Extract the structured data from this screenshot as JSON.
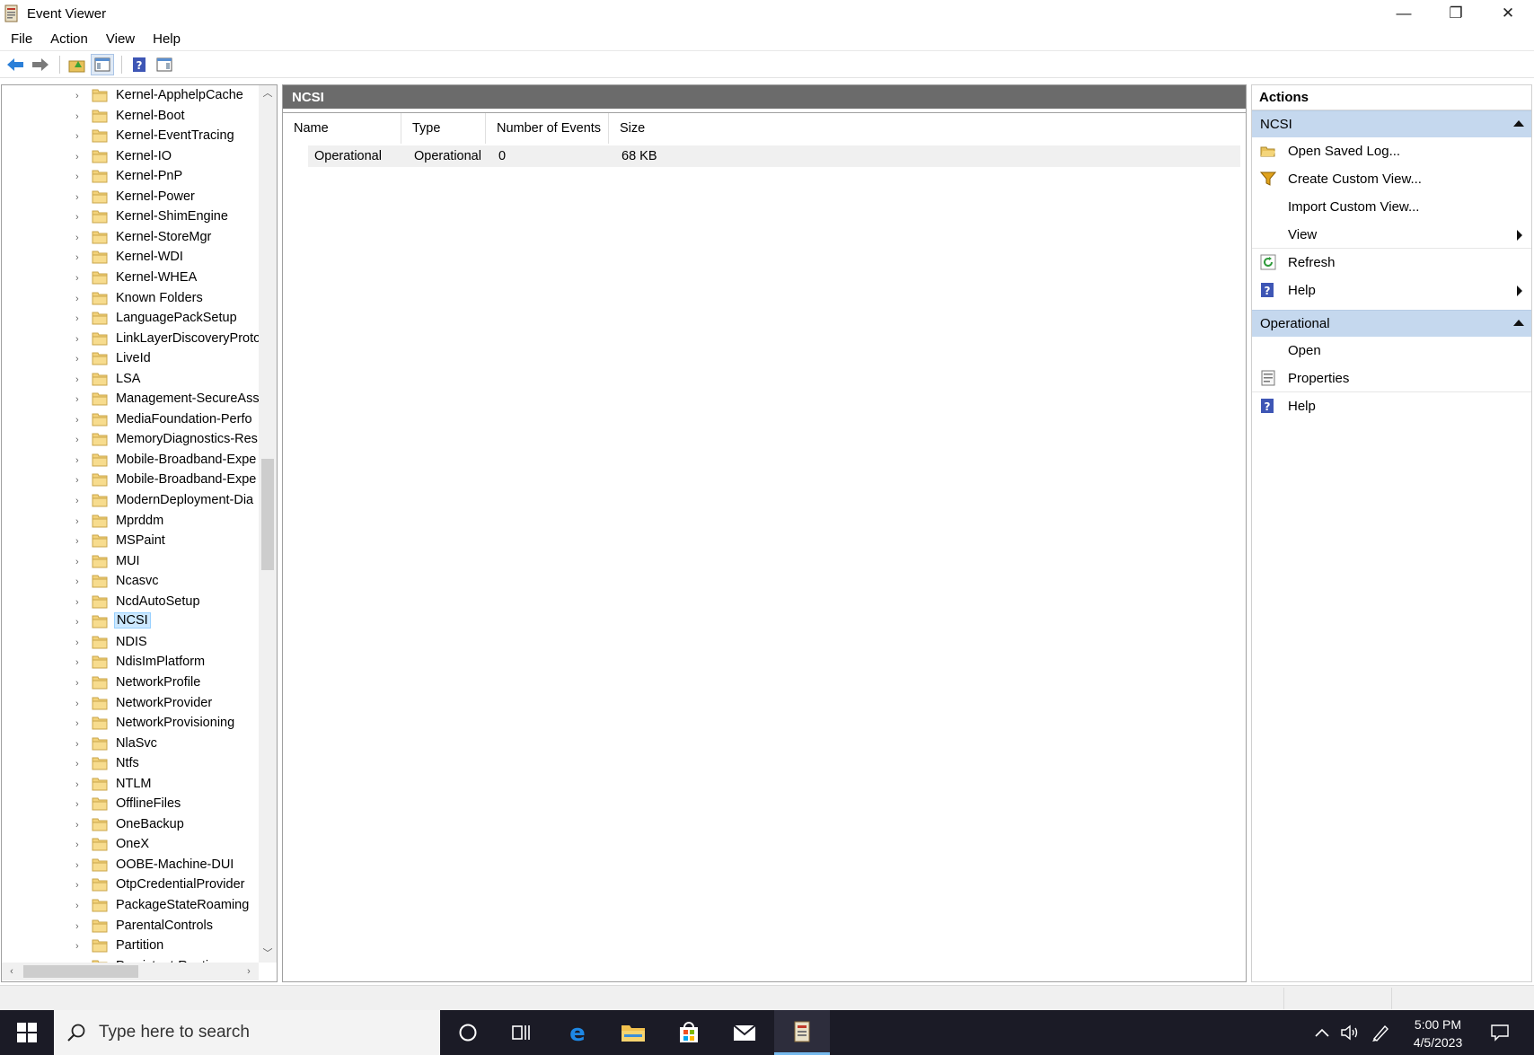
{
  "window": {
    "title": "Event Viewer",
    "minimize": "—",
    "restore": "❐",
    "close": "✕"
  },
  "menu": [
    "File",
    "Action",
    "View",
    "Help"
  ],
  "tree": {
    "items": [
      "Kernel-ApphelpCache",
      "Kernel-Boot",
      "Kernel-EventTracing",
      "Kernel-IO",
      "Kernel-PnP",
      "Kernel-Power",
      "Kernel-ShimEngine",
      "Kernel-StoreMgr",
      "Kernel-WDI",
      "Kernel-WHEA",
      "Known Folders",
      "LanguagePackSetup",
      "LinkLayerDiscoveryProto",
      "LiveId",
      "LSA",
      "Management-SecureAss",
      "MediaFoundation-Perfo",
      "MemoryDiagnostics-Res",
      "Mobile-Broadband-Expe",
      "Mobile-Broadband-Expe",
      "ModernDeployment-Dia",
      "Mprddm",
      "MSPaint",
      "MUI",
      "Ncasvc",
      "NcdAutoSetup",
      "NCSI",
      "NDIS",
      "NdisImPlatform",
      "NetworkProfile",
      "NetworkProvider",
      "NetworkProvisioning",
      "NlaSvc",
      "Ntfs",
      "NTLM",
      "OfflineFiles",
      "OneBackup",
      "OneX",
      "OOBE-Machine-DUI",
      "OtpCredentialProvider",
      "PackageStateRoaming",
      "ParentalControls",
      "Partition",
      "Persistent-Routing"
    ],
    "selected": "NCSI"
  },
  "center": {
    "header": "NCSI",
    "columns": [
      "Name",
      "Type",
      "Number of Events",
      "Size"
    ],
    "rows": [
      {
        "name": "Operational",
        "type": "Operational",
        "events": "0",
        "size": "68 KB"
      }
    ]
  },
  "actions": {
    "title": "Actions",
    "sections": [
      {
        "header": "NCSI",
        "items": [
          "Open Saved Log...",
          "Create Custom View...",
          "Import Custom View...",
          "View",
          "Refresh",
          "Help"
        ]
      },
      {
        "header": "Operational",
        "items": [
          "Open",
          "Properties",
          "Help"
        ]
      }
    ]
  },
  "taskbar": {
    "search_placeholder": "Type here to search",
    "time": "5:00 PM",
    "date": "4/5/2023"
  },
  "colors": {
    "selection": "#cce8ff",
    "section_header": "#c5d8ee",
    "center_header": "#6b6b6b",
    "taskbar": "#1b1b26"
  }
}
